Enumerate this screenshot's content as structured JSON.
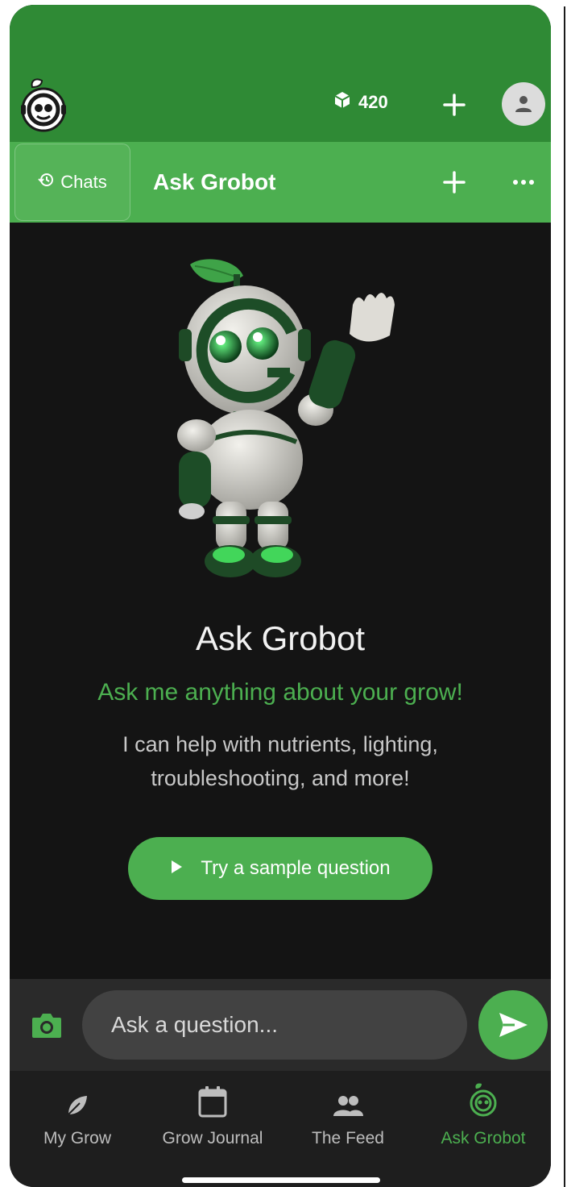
{
  "header": {
    "credits": "420",
    "colors": {
      "header": "#2f8a35",
      "accent": "#4caf50"
    }
  },
  "subheader": {
    "chats_label": "Chats",
    "title": "Ask Grobot"
  },
  "hero": {
    "title": "Ask Grobot",
    "tagline": "Ask me anything about your grow!",
    "description": "I can help with nutrients, lighting, troubleshooting, and more!",
    "sample_button": "Try a sample question"
  },
  "input": {
    "placeholder": "Ask a question..."
  },
  "nav": {
    "items": [
      {
        "label": "My Grow",
        "icon": "leaf-icon"
      },
      {
        "label": "Grow Journal",
        "icon": "calendar-icon"
      },
      {
        "label": "The Feed",
        "icon": "people-icon"
      },
      {
        "label": "Ask Grobot",
        "icon": "grobot-icon",
        "active": true
      }
    ]
  }
}
